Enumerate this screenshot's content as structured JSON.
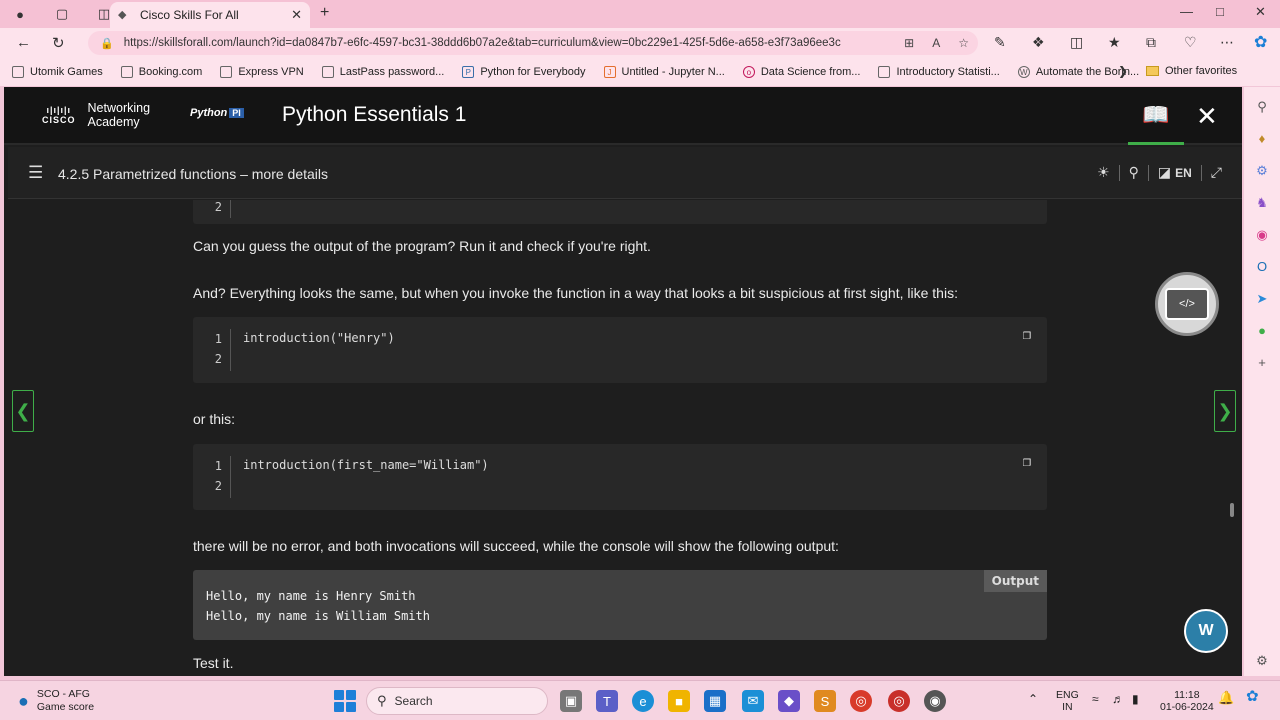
{
  "browser": {
    "tab_title": "Cisco Skills For All",
    "url": "https://skillsforall.com/launch?id=da0847b7-e6fc-4597-bc31-38ddd6b07a2e&tab=curriculum&view=0bc229e1-425f-5d6e-a658-e3f73a96ee3c",
    "bookmarks": [
      "Utomik Games",
      "Booking.com",
      "Express VPN",
      "LastPass password...",
      "Python for Everybody",
      "Untitled - Jupyter N...",
      "Data Science from...",
      "Introductory Statisti...",
      "Automate the Borin..."
    ],
    "other_favorites": "Other favorites"
  },
  "app": {
    "brand_line1": "Networking",
    "brand_line2": "Academy",
    "cisco_text": "CISCO",
    "python_logo": "Python",
    "python_logo_badge": "PI",
    "course_title": "Python Essentials 1",
    "section_title": "4.2.5 Parametrized functions – more details",
    "language": "EN"
  },
  "content": {
    "top_line_number": "2",
    "para1": "Can you guess the output of the program? Run it and check if you're right.",
    "para2": "And? Everything looks the same, but when you invoke the function in a way that looks a bit suspicious at first sight, like this:",
    "code1": {
      "line_numbers": [
        "1",
        "2"
      ],
      "line1": "introduction(\"Henry\")",
      "line2": ""
    },
    "para3": "or this:",
    "code2": {
      "line_numbers": [
        "1",
        "2"
      ],
      "line1": "introduction(first_name=\"William\")",
      "line2": ""
    },
    "para4": "there will be no error, and both invocations will succeed, while the console will show the following output:",
    "output": {
      "label": "Output",
      "line1": "Hello, my name is Henry Smith",
      "line2": "Hello, my name is William Smith"
    },
    "para5": "Test it."
  },
  "taskbar": {
    "weather_title": "SCO - AFG",
    "weather_sub": "Game score",
    "search_placeholder": "Search",
    "lang_line1": "ENG",
    "lang_line2": "IN",
    "time": "11:18",
    "date": "01-06-2024"
  }
}
